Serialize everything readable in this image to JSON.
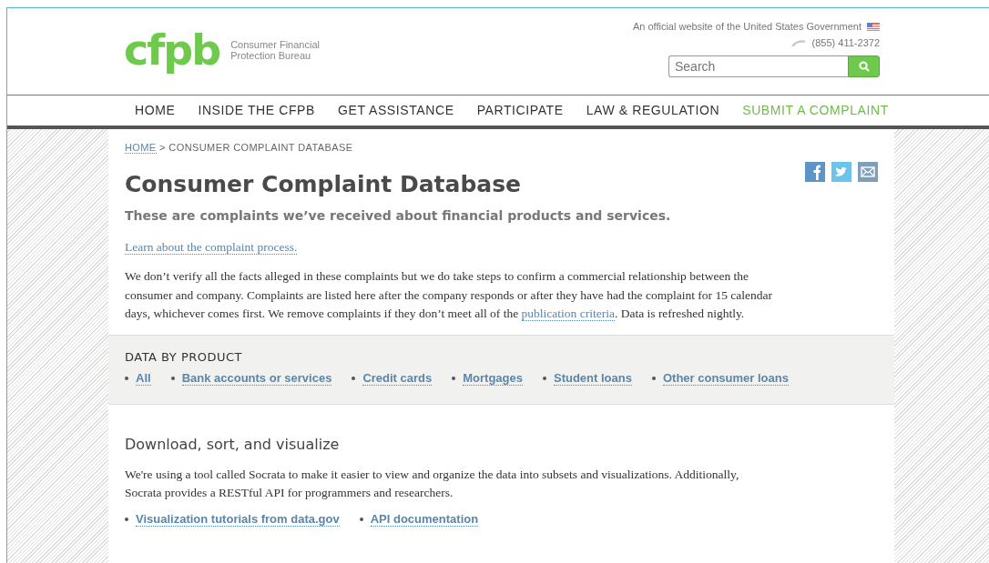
{
  "header": {
    "logo": "cfpb",
    "agency": [
      "Consumer Financial",
      "Protection Bureau"
    ],
    "official": "An official website of the United States Government",
    "phone": "(855) 411-2372",
    "search": {
      "placeholder": "Search"
    }
  },
  "nav": [
    {
      "label": "HOME",
      "selected": false
    },
    {
      "label": "INSIDE THE CFPB",
      "selected": false
    },
    {
      "label": "GET ASSISTANCE",
      "selected": false
    },
    {
      "label": "PARTICIPATE",
      "selected": false
    },
    {
      "label": "LAW & REGULATION",
      "selected": false
    },
    {
      "label": "SUBMIT A COMPLAINT",
      "selected": true
    }
  ],
  "breadcrumb": {
    "link": "HOME",
    "separator": ">",
    "current": "CONSUMER COMPLAINT DATABASE"
  },
  "title": "Consumer Complaint Database",
  "subtitle": "These are complaints we’ve received about financial products and services.",
  "process_link": "Learn about the complaint process.",
  "intro": {
    "before": "We don’t verify all the facts alleged in these complaints but we do take steps to confirm a commercial relationship between the consumer and company. Complaints are listed here after the company responds or after they have had the complaint for 15 calendar days, whichever comes first. We remove complaints if they don’t meet all of the",
    "link": "publication criteria",
    "after": ". Data is refreshed nightly."
  },
  "products": {
    "heading": "DATA BY PRODUCT",
    "links": [
      "All",
      "Bank accounts or services",
      "Credit cards",
      "Mortgages",
      "Student loans",
      "Other consumer loans"
    ]
  },
  "download": {
    "heading": "Download, sort, and visualize",
    "text": "We're using a tool called Socrata to make it easier to view and organize the data into subsets and visualizations. Additionally, Socrata provides a RESTful API for programmers and researchers.",
    "links": [
      "Visualization tutorials from data.gov",
      "API documentation"
    ]
  }
}
